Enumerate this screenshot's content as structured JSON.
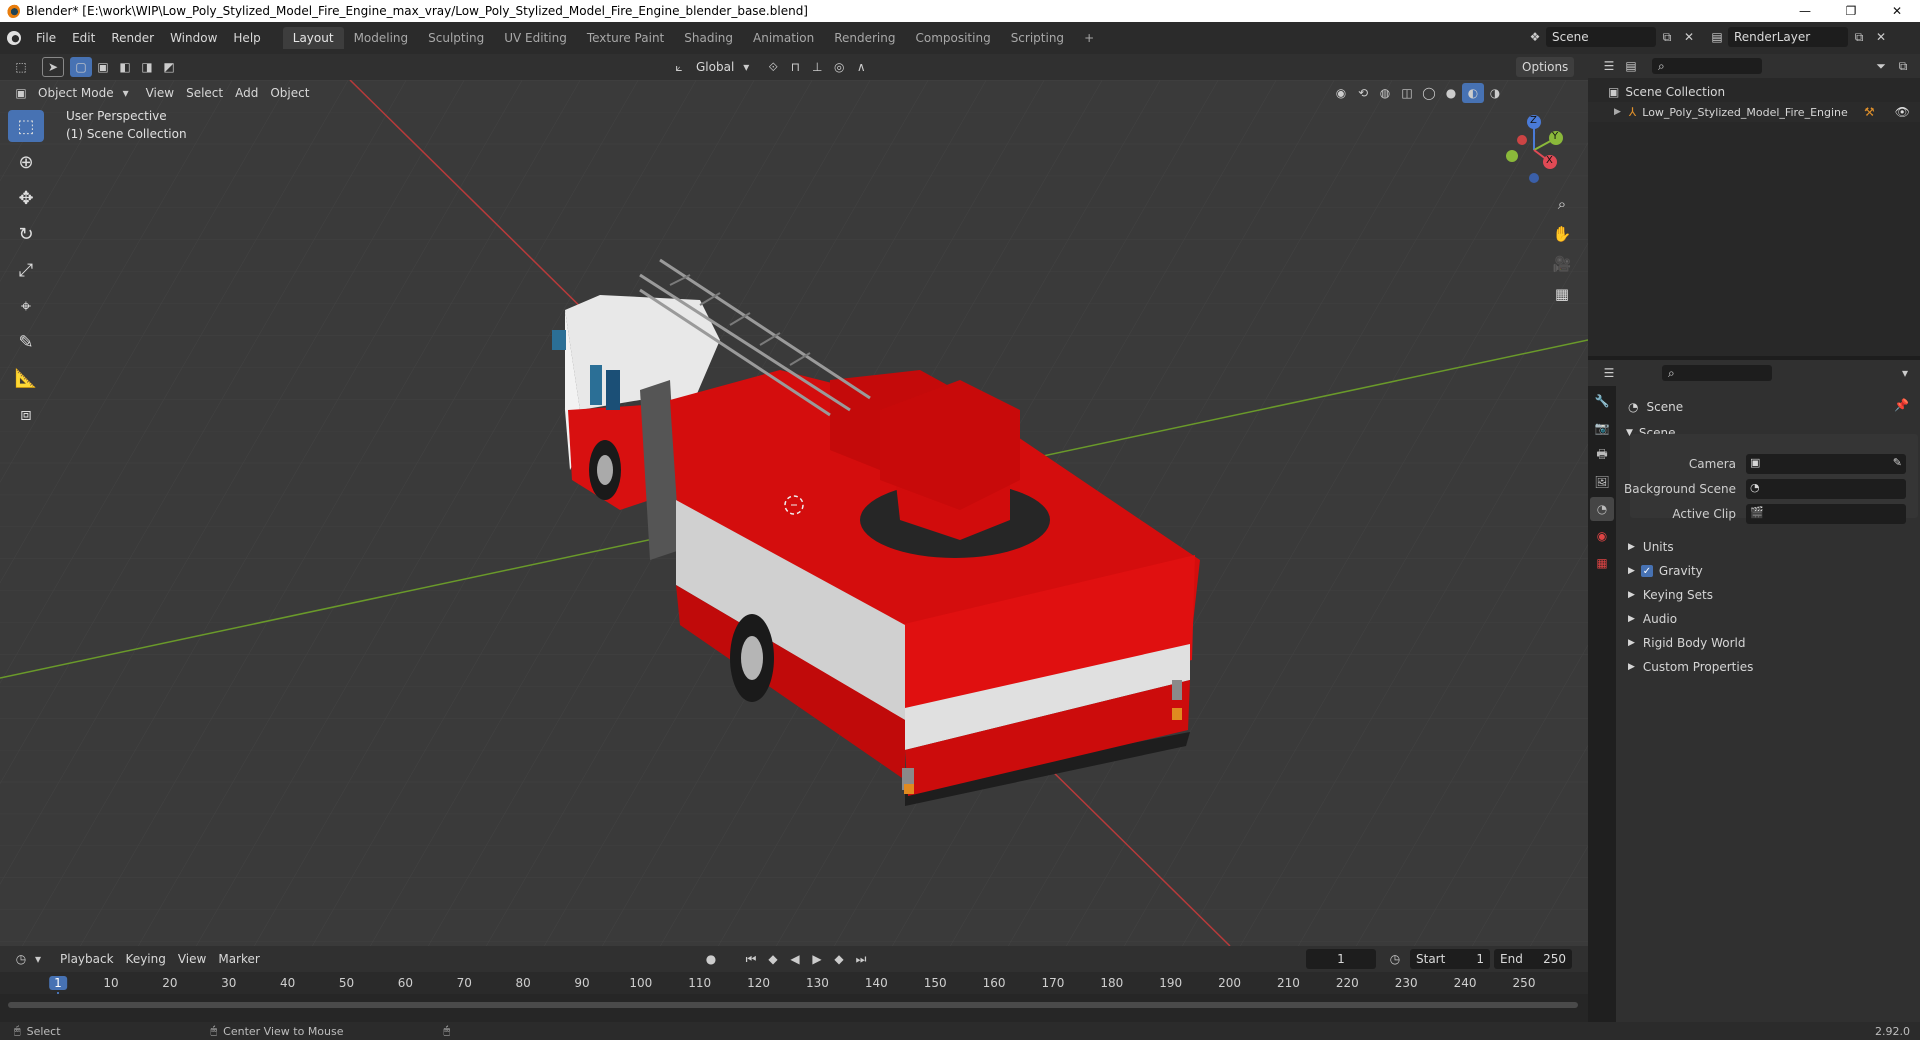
{
  "window": {
    "title": "Blender* [E:\\work\\WIP\\Low_Poly_Stylized_Model_Fire_Engine_max_vray/Low_Poly_Stylized_Model_Fire_Engine_blender_base.blend]",
    "controls": [
      "—",
      "❐",
      "✕"
    ]
  },
  "menu": [
    "File",
    "Edit",
    "Render",
    "Window",
    "Help"
  ],
  "workspaces": [
    {
      "label": "Layout",
      "active": true
    },
    {
      "label": "Modeling"
    },
    {
      "label": "Sculpting"
    },
    {
      "label": "UV Editing"
    },
    {
      "label": "Texture Paint"
    },
    {
      "label": "Shading"
    },
    {
      "label": "Animation"
    },
    {
      "label": "Rendering"
    },
    {
      "label": "Compositing"
    },
    {
      "label": "Scripting"
    }
  ],
  "add_workspace": "+",
  "scene_field": "Scene",
  "renderlayer_field": "RenderLayer",
  "tool_header": {
    "orientation": "Global",
    "options": "Options"
  },
  "viewport_header": {
    "mode": "Object Mode",
    "menus": [
      "View",
      "Select",
      "Add",
      "Object"
    ]
  },
  "viewport": {
    "overlay_line1": "User Perspective",
    "overlay_line2": "(1) Scene Collection",
    "gizmo": {
      "z": "Z",
      "y": "Y",
      "x": "X"
    }
  },
  "outliner": {
    "root": "Scene Collection",
    "items": [
      "Low_Poly_Stylized_Model_Fire_Engine"
    ]
  },
  "properties": {
    "context": "Scene",
    "panel_title": "Scene",
    "fields": [
      {
        "label": "Camera"
      },
      {
        "label": "Background Scene"
      },
      {
        "label": "Active Clip"
      }
    ],
    "sections": [
      "Units",
      "Gravity",
      "Keying Sets",
      "Audio",
      "Rigid Body World",
      "Custom Properties"
    ],
    "gravity_checked": true
  },
  "timeline": {
    "menus": [
      "Playback",
      "Keying",
      "View",
      "Marker"
    ],
    "current_frame": "1",
    "start_label": "Start",
    "start": "1",
    "end_label": "End",
    "end": "250",
    "ruler": [
      "1",
      "10",
      "20",
      "30",
      "40",
      "50",
      "60",
      "70",
      "80",
      "90",
      "100",
      "110",
      "120",
      "130",
      "140",
      "150",
      "160",
      "170",
      "180",
      "190",
      "200",
      "210",
      "220",
      "230",
      "240",
      "250"
    ]
  },
  "statusbar": {
    "select": "Select",
    "center_view": "Center View to Mouse",
    "version": "2.92.0"
  },
  "colors": {
    "accent": "#4772b3",
    "truck_red": "#d40d0d",
    "x_axis": "#b83a3a",
    "y_axis": "#6a9a2a"
  }
}
